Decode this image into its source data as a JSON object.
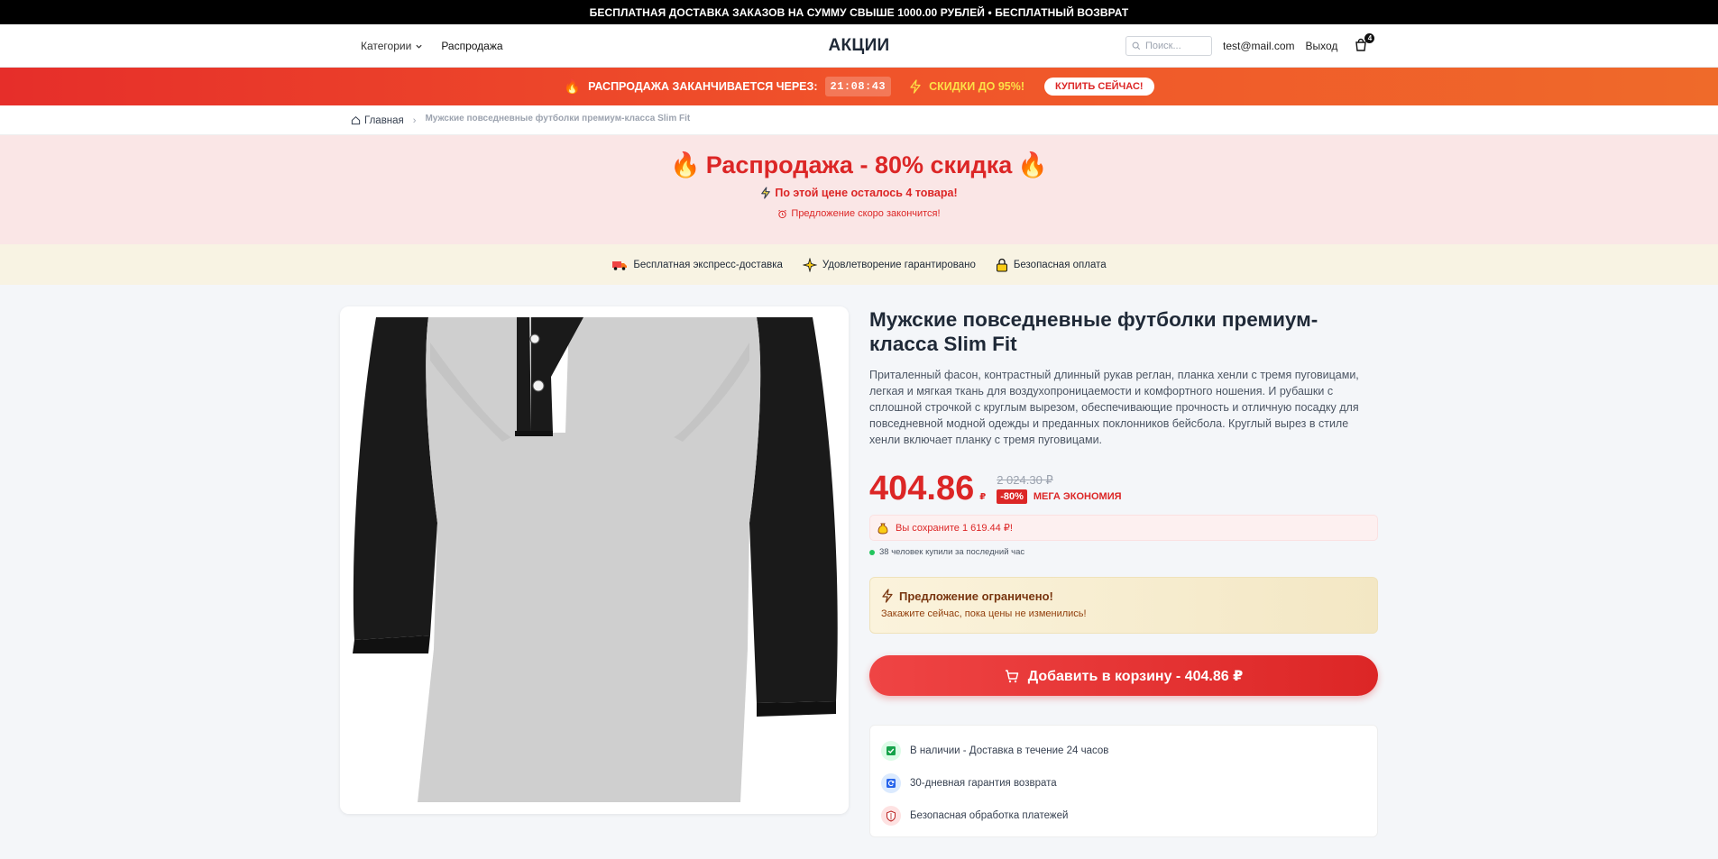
{
  "topbar": {
    "text": "БЕСПЛАТНАЯ ДОСТАВКА ЗАКАЗОВ НА СУММУ СВЫШЕ 1000.00 РУБЛЕЙ • БЕСПЛАТНЫЙ ВОЗВРАТ"
  },
  "header": {
    "categories": "Категории",
    "sale": "Распродажа",
    "logo": "АКЦИИ",
    "search_placeholder": "Поиск...",
    "email": "test@mail.com",
    "logout": "Выход",
    "cart_count": "4"
  },
  "salebar": {
    "ends_label": "РАСПРОДАЖА ЗАКАНЧИВАЕТСЯ ЧЕРЕЗ:",
    "timer": "21:08:43",
    "discount": "СКИДКИ ДО 95%!",
    "buy_now": "КУПИТЬ СЕЙЧАС!"
  },
  "breadcrumb": {
    "home": "Главная",
    "current": "Мужские повседневные футболки премиум-класса Slim Fit"
  },
  "hero": {
    "title": "Распродажа - 80% скидка",
    "stock_left": "По этой цене осталось 4 товара!",
    "ending": "Предложение скоро закончится!"
  },
  "trust": {
    "delivery": "Бесплатная экспресс-доставка",
    "satisfaction": "Удовлетворение гарантировано",
    "payment": "Безопасная оплата"
  },
  "product": {
    "title": "Мужские повседневные футболки премиум-класса Slim Fit",
    "description": "Приталенный фасон, контрастный длинный рукав реглан, планка хенли с тремя пуговицами, легкая и мягкая ткань для воздухопроницаемости и комфортного ношения. И рубашки с сплошной строчкой с круглым вырезом, обеспечивающие прочность и отличную посадку для повседневной модной одежды и преданных поклонников бейсбола. Круглый вырез в стиле хенли включает планку с тремя пуговицами.",
    "price": "404.86",
    "currency": "₽",
    "old_price": "2 024.30 ₽",
    "discount_badge": "-80%",
    "mega": "МЕГА ЭКОНОМИЯ",
    "savings": "Вы сохраните 1 619.44 ₽!",
    "buyers": "38 человек купили за последний час",
    "limited_title": "Предложение ограничено!",
    "limited_sub": "Закажите сейчас, пока цены не изменились!",
    "add_to_cart": "Добавить в корзину - 404.86 ₽",
    "feature_stock": "В наличии - Доставка в течение 24 часов",
    "feature_return": "30-дневная гарантия возврата",
    "feature_secure": "Безопасная обработка платежей"
  },
  "colors": {
    "accent": "#dc2626",
    "success": "#22c55e"
  }
}
